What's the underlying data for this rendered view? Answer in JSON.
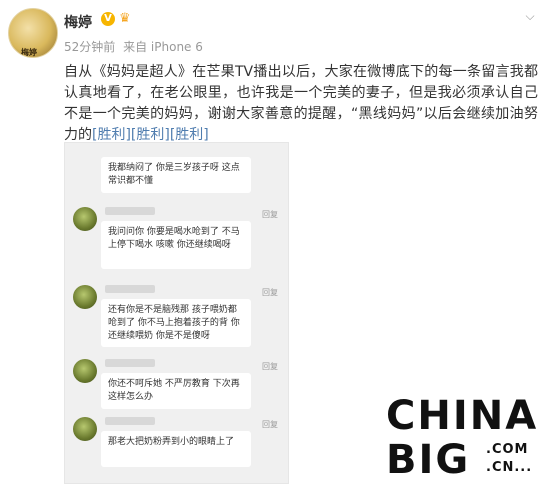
{
  "post": {
    "username": "梅婷",
    "verified_badge": "V",
    "crown_icon": "crown-icon",
    "avatar_text": "梅婷",
    "time": "52分钟前",
    "source": "来自 iPhone 6",
    "text_before": "自从《妈妈是超人》在芒果TV播出以后，大家在微博底下的每一条留言我都认真地看了，在老公眼里，也许我是一个完美的妻子，但是我必须承认自己不是一个完美的妈妈，谢谢大家善意的提醒，“黑线妈妈”以后会继续加油努力的",
    "emoticons": "[胜利][胜利][胜利]"
  },
  "comments": [
    {
      "text": "我都纳闷了 你是三岁孩子呀 这点常识都不懂",
      "reply": ""
    },
    {
      "text": "我问问你 你要是喝水呛到了 不马上停下喝水 咳嗽 你还继续喝呀",
      "reply": "回复"
    },
    {
      "text": "还有你是不是脑残那 孩子喂奶都呛到了 你不马上抱着孩子的背 你还继续喂奶 你是不是傻呀",
      "reply": "回复"
    },
    {
      "text": "你还不呵斥她 不严厉教育 下次再这样怎么办",
      "reply": "回复"
    },
    {
      "text": "那老大把奶粉弄到小的眼睛上了",
      "reply": "回复"
    }
  ],
  "watermark": {
    "line1": "CHINA",
    "line2": "BIG",
    "line3": ".COM",
    "line4": ".CN..."
  },
  "colors": {
    "accent_link": "#507daf",
    "verified": "#f7b500"
  }
}
